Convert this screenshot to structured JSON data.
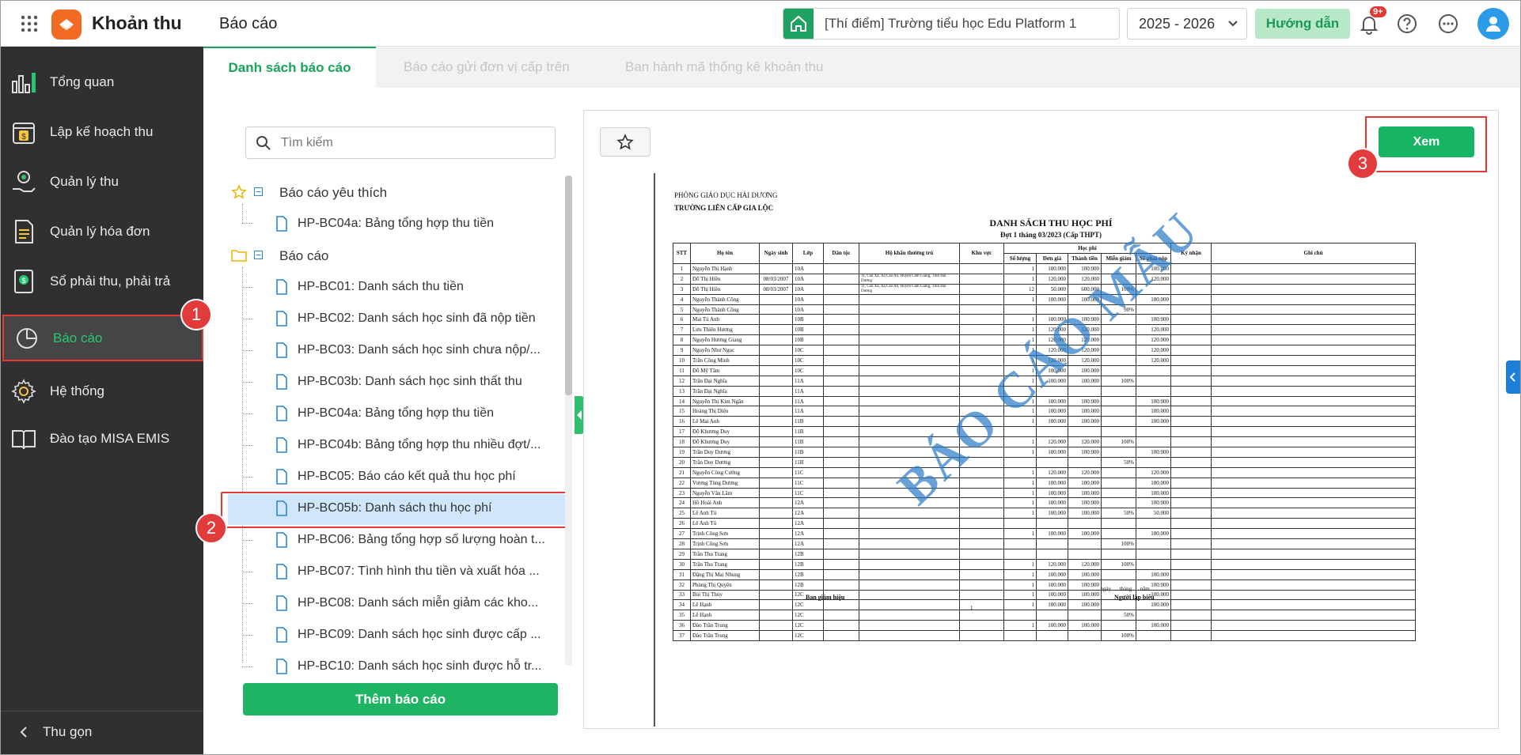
{
  "header": {
    "app_title": "Khoản thu",
    "page_title": "Báo cáo",
    "school": "[Thí điểm] Trường tiểu học Edu Platform 1",
    "year": "2025 - 2026",
    "guide_label": "Hướng dẫn",
    "notification_badge": "9+"
  },
  "sidebar": {
    "items": [
      {
        "label": "Tổng quan",
        "icon": "chart-bars-icon"
      },
      {
        "label": "Lập kế hoạch thu",
        "icon": "calendar-money-icon"
      },
      {
        "label": "Quản lý thu",
        "icon": "hand-coin-icon"
      },
      {
        "label": "Quản lý hóa đơn",
        "icon": "invoice-icon"
      },
      {
        "label": "Sổ phải thu, phải trả",
        "icon": "ledger-icon"
      },
      {
        "label": "Báo cáo",
        "icon": "pie-chart-icon"
      },
      {
        "label": "Hệ thống",
        "icon": "gear-icon"
      },
      {
        "label": "Đào tạo MISA EMIS",
        "icon": "book-icon"
      }
    ],
    "collapse_label": "Thu gọn"
  },
  "tabs": [
    "Danh sách báo cáo",
    "Báo cáo gửi đơn vị cấp trên",
    "Ban hành mã thống kê khoản thu"
  ],
  "search": {
    "placeholder": "Tìm kiếm"
  },
  "tree": {
    "favorites_label": "Báo cáo yêu thích",
    "favorites": [
      "HP-BC04a: Bảng tổng hợp thu tiền"
    ],
    "reports_label": "Báo cáo",
    "reports": [
      "HP-BC01: Danh sách thu tiền",
      "HP-BC02: Danh sách học sinh đã nộp tiền",
      "HP-BC03: Danh sách học sinh chưa nộp/...",
      "HP-BC03b: Danh sách học sinh thất thu",
      "HP-BC04a: Bảng tổng hợp thu tiền",
      "HP-BC04b: Bảng tổng hợp thu nhiều đợt/...",
      "HP-BC05: Báo cáo kết quả thu học phí",
      "HP-BC05b: Danh sách thu học phí",
      "HP-BC06: Bảng tổng hợp số lượng hoàn t...",
      "HP-BC07: Tình hình thu tiền và xuất hóa ...",
      "HP-BC08: Danh sách miễn giảm các kho...",
      "HP-BC09: Danh sách học sinh được cấp ...",
      "HP-BC10: Danh sách học sinh được hỗ tr..."
    ]
  },
  "add_report_label": "Thêm báo cáo",
  "view_label": "Xem",
  "markers": [
    "1",
    "2",
    "3"
  ],
  "document": {
    "org1": "PHÒNG GIÁO DỤC HẢI DƯƠNG",
    "org2": "TRƯỜNG LIÊN CẤP GIA LỘC",
    "title": "DANH SÁCH THU HỌC PHÍ",
    "subtitle": "Đợt 1 tháng 03/2023 (Cấp THPT)",
    "watermark": "BÁO CÁO MẪU",
    "headers": [
      "STT",
      "Họ tên",
      "Ngày sinh",
      "Lớp",
      "Dân tộc",
      "Hộ khẩu thường trú",
      "Khu vực",
      "Học phí",
      "Ký nhận",
      "Ghi chú"
    ],
    "fee_headers": [
      "Số lượng",
      "Đơn giá",
      "Thành tiền",
      "Miễn giảm",
      "Số phải nộp"
    ],
    "rows": [
      [
        "1",
        "Nguyễn Thị Hạnh",
        "",
        "10A",
        "",
        "",
        "",
        "1",
        "100.000",
        "100.000",
        "",
        "100.000"
      ],
      [
        "2",
        "Đỗ Thị Hiền",
        "08/03/2007",
        "10A",
        "",
        "11, Cao Xá, Xã Cao An, Huyện Cẩm Giàng, Tỉnh Hải Dương",
        "",
        "1",
        "120.000",
        "120.000",
        "",
        "120.000"
      ],
      [
        "3",
        "Đỗ Thị Hiền",
        "08/03/2007",
        "10A",
        "",
        "11, Cao Xá, Xã Cao An, Huyện Cẩm Giàng, Tỉnh Hải Dương",
        "",
        "12",
        "50.000",
        "600.000",
        "100%",
        ""
      ],
      [
        "4",
        "Nguyễn Thành Công",
        "",
        "10A",
        "",
        "",
        "",
        "1",
        "100.000",
        "100.000",
        "",
        "100.000"
      ],
      [
        "5",
        "Nguyễn Thành Công",
        "",
        "10A",
        "",
        "",
        "",
        "",
        "",
        "",
        "90%",
        ""
      ],
      [
        "6",
        "Mai Tú Anh",
        "",
        "10B",
        "",
        "",
        "",
        "1",
        "100.000",
        "100.000",
        "",
        "100.000"
      ],
      [
        "7",
        "Lưu Thiên Hương",
        "",
        "10B",
        "",
        "",
        "",
        "1",
        "120.000",
        "120.000",
        "",
        "120.000"
      ],
      [
        "8",
        "Nguyễn Hương Giang",
        "",
        "10B",
        "",
        "",
        "",
        "1",
        "120.000",
        "120.000",
        "",
        "120.000"
      ],
      [
        "9",
        "Nguyễn Như Ngọc",
        "",
        "10C",
        "",
        "",
        "",
        "1",
        "120.000",
        "120.000",
        "",
        "120.000"
      ],
      [
        "10",
        "Trần Công Minh",
        "",
        "10C",
        "",
        "",
        "",
        "1",
        "120.000",
        "120.000",
        "",
        "120.000"
      ],
      [
        "11",
        "Đỗ Mỹ Tâm",
        "",
        "10C",
        "",
        "",
        "",
        "1",
        "100.000",
        "100.000",
        "",
        ""
      ],
      [
        "12",
        "Trần Đại Nghĩa",
        "",
        "11A",
        "",
        "",
        "",
        "1",
        "100.000",
        "100.000",
        "100%",
        ""
      ],
      [
        "13",
        "Trần Đại Nghĩa",
        "",
        "11A",
        "",
        "",
        "",
        "",
        "",
        "",
        "",
        ""
      ],
      [
        "14",
        "Nguyễn Thị Kim Ngân",
        "",
        "11A",
        "",
        "",
        "",
        "1",
        "100.000",
        "100.000",
        "",
        "100.000"
      ],
      [
        "15",
        "Hoàng Thị Diệu",
        "",
        "11A",
        "",
        "",
        "",
        "1",
        "100.000",
        "100.000",
        "",
        "100.000"
      ],
      [
        "16",
        "Lê Mai Anh",
        "",
        "11B",
        "",
        "",
        "",
        "1",
        "100.000",
        "100.000",
        "",
        "100.000"
      ],
      [
        "17",
        "Đỗ Khương Duy",
        "",
        "11B",
        "",
        "",
        "",
        "",
        "",
        "",
        "",
        ""
      ],
      [
        "18",
        "Đỗ Khương Duy",
        "",
        "11B",
        "",
        "",
        "",
        "1",
        "120.000",
        "120.000",
        "100%",
        ""
      ],
      [
        "19",
        "Trần Duy Dương",
        "",
        "11B",
        "",
        "",
        "",
        "1",
        "100.000",
        "100.000",
        "",
        "100.000"
      ],
      [
        "20",
        "Trần Duy Dương",
        "",
        "11B",
        "",
        "",
        "",
        "",
        "",
        "",
        "50%",
        ""
      ],
      [
        "21",
        "Nguyễn Công Cường",
        "",
        "11C",
        "",
        "",
        "",
        "1",
        "120.000",
        "120.000",
        "",
        "120.000"
      ],
      [
        "22",
        "Vương Tùng Dương",
        "",
        "11C",
        "",
        "",
        "",
        "1",
        "100.000",
        "100.000",
        "",
        "100.000"
      ],
      [
        "23",
        "Nguyễn Văn Lâm",
        "",
        "11C",
        "",
        "",
        "",
        "1",
        "100.000",
        "100.000",
        "",
        "100.000"
      ],
      [
        "24",
        "Hồ Hoài Anh",
        "",
        "12A",
        "",
        "",
        "",
        "1",
        "100.000",
        "100.000",
        "",
        "100.000"
      ],
      [
        "25",
        "Lê Anh Tú",
        "",
        "12A",
        "",
        "",
        "",
        "1",
        "100.000",
        "100.000",
        "50%",
        "50.000"
      ],
      [
        "26",
        "Lê Anh Tú",
        "",
        "12A",
        "",
        "",
        "",
        "",
        "",
        "",
        "",
        ""
      ],
      [
        "27",
        "Trịnh Công Sơn",
        "",
        "12A",
        "",
        "",
        "",
        "1",
        "100.000",
        "100.000",
        "",
        "100.000"
      ],
      [
        "28",
        "Trịnh Công Sơn",
        "",
        "12A",
        "",
        "",
        "",
        "",
        "",
        "",
        "100%",
        ""
      ],
      [
        "29",
        "Trần Thu Trang",
        "",
        "12B",
        "",
        "",
        "",
        "",
        "",
        "",
        "",
        ""
      ],
      [
        "30",
        "Trần Thu Trang",
        "",
        "12B",
        "",
        "",
        "",
        "1",
        "120.000",
        "120.000",
        "100%",
        ""
      ],
      [
        "31",
        "Đặng Thị Mai Nhung",
        "",
        "12B",
        "",
        "",
        "",
        "1",
        "100.000",
        "100.000",
        "",
        "100.000"
      ],
      [
        "32",
        "Phùng Thị Quyên",
        "",
        "12B",
        "",
        "",
        "",
        "1",
        "100.000",
        "100.000",
        "",
        "100.000"
      ],
      [
        "33",
        "Bùi Thị Thủy",
        "",
        "12C",
        "",
        "",
        "",
        "1",
        "100.000",
        "100.000",
        "",
        "100.000"
      ],
      [
        "34",
        "Lê Hạnh",
        "",
        "12C",
        "",
        "",
        "",
        "1",
        "100.000",
        "100.000",
        "",
        "100.000"
      ],
      [
        "35",
        "Lê Hạnh",
        "",
        "12C",
        "",
        "",
        "",
        "",
        "",
        "",
        "50%",
        ""
      ],
      [
        "36",
        "Đào Trần Trung",
        "",
        "12C",
        "",
        "",
        "",
        "1",
        "100.000",
        "100.000",
        "",
        "100.000"
      ],
      [
        "37",
        "Đào Trần Trung",
        "",
        "12C",
        "",
        "",
        "",
        "",
        "",
        "",
        "100%",
        ""
      ]
    ],
    "date_line": "............, ngày .... tháng .... năm ........",
    "left_sign": "Ban giám hiệu",
    "right_sign": "Người lập biểu",
    "page_no": "1"
  }
}
